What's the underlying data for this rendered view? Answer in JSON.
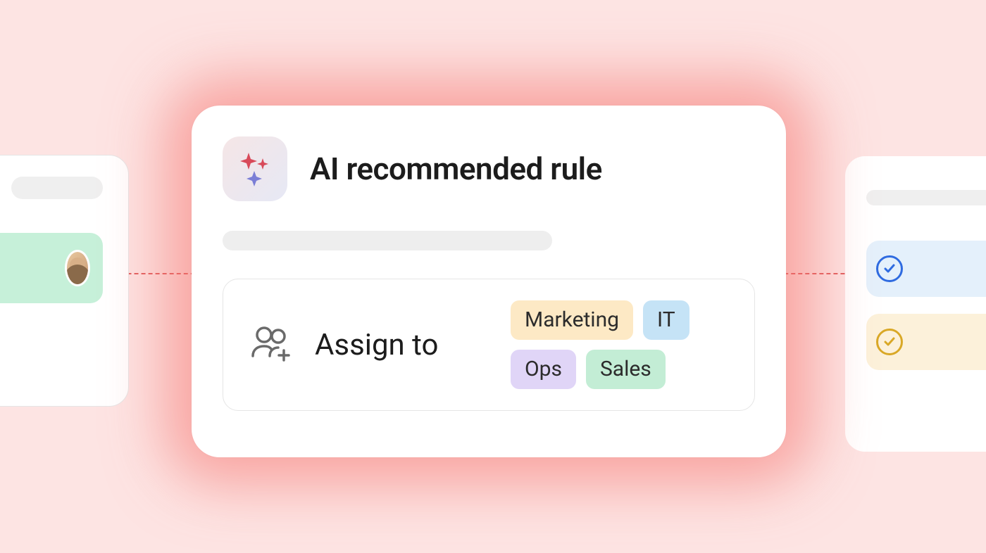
{
  "main": {
    "title": "AI recommended rule",
    "assign_label": "Assign to",
    "tags": [
      "Marketing",
      "IT",
      "Ops",
      "Sales"
    ]
  },
  "colors": {
    "bg": "#fde4e3",
    "glow": "#f4716b",
    "tag_marketing": "#fde9c5",
    "tag_it": "#c5e3f6",
    "tag_ops": "#e0d5f7",
    "tag_sales": "#c3edd5",
    "left_row": "#c6f0d9",
    "right_row_1": "#e4f0fb",
    "right_row_2": "#fcf1da"
  }
}
